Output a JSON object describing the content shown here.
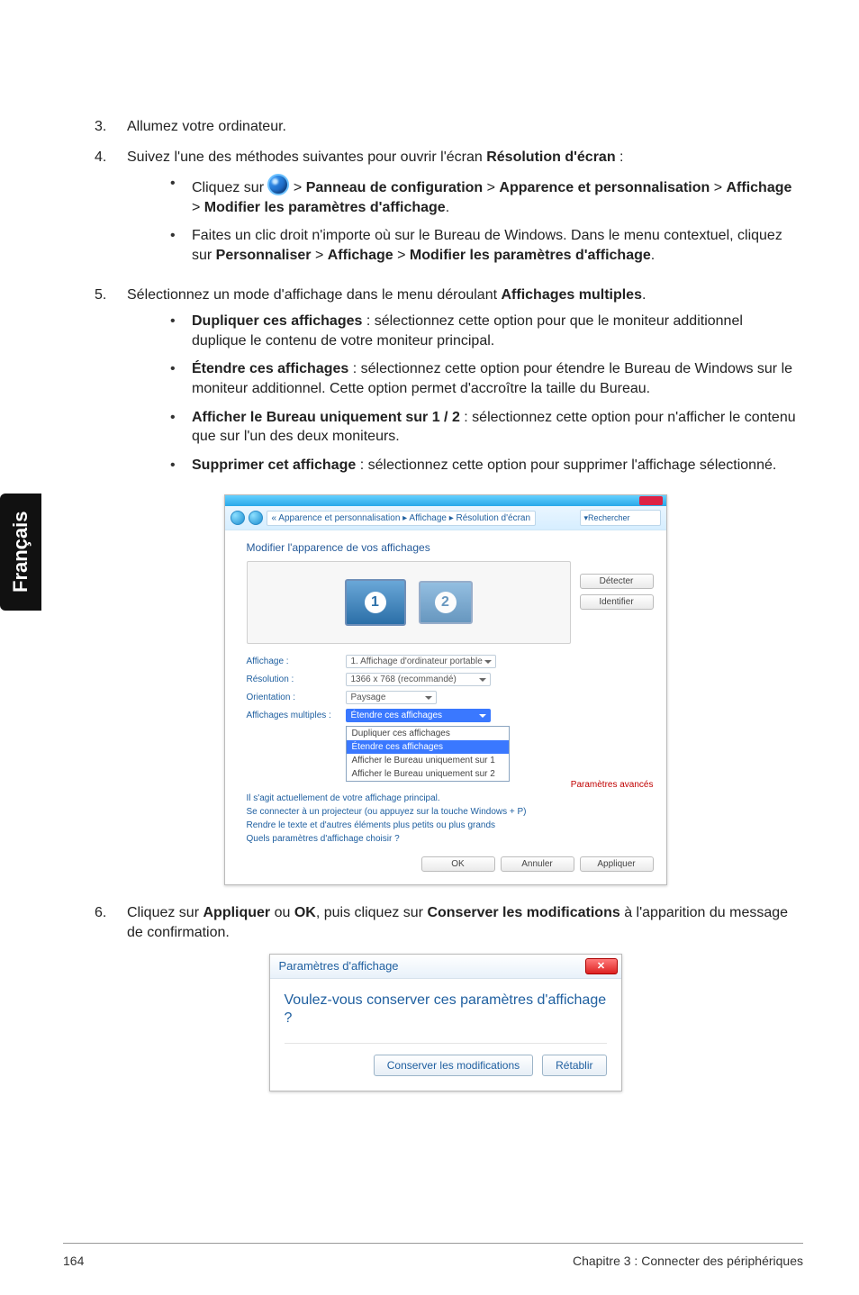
{
  "sidetab": "Français",
  "steps": {
    "s3": {
      "num": "3.",
      "text": "Allumez votre ordinateur."
    },
    "s4": {
      "num": "4.",
      "intro_a": "Suivez l'une des méthodes suivantes pour ouvrir l'écran ",
      "intro_bold": "Résolution d'écran",
      "intro_c": " :",
      "b1a": "Cliquez sur ",
      "b1b": " > ",
      "b1_p1": "Panneau de configuration",
      "b1c": " > ",
      "b1_p2": "Apparence et personnalisation",
      "b1d": " > ",
      "b1_p3": "Affichage",
      "b1e": " > ",
      "b1_p4": "Modifier les paramètres d'affichage",
      "b1f": ".",
      "b2a": "Faites un clic droit n'importe où sur le Bureau de Windows. Dans le menu contextuel, cliquez sur ",
      "b2_p1": "Personnaliser",
      "b2b": " > ",
      "b2_p2": "Affichage",
      "b2c": " > ",
      "b2_p3": "Modifier les paramètres d'affichage",
      "b2d": "."
    },
    "s5": {
      "num": "5.",
      "intro_a": "Sélectionnez un mode d'affichage dans le menu déroulant ",
      "intro_bold": "Affichages multiples",
      "intro_c": ".",
      "b1_t": "Dupliquer ces affichages",
      "b1_r": " : sélectionnez cette option pour que le moniteur additionnel duplique le contenu de votre moniteur principal.",
      "b2_t": "Étendre ces affichages",
      "b2_r": " : sélectionnez cette option pour étendre le Bureau de Windows sur le moniteur additionnel. Cette option permet d'accroître la taille du Bureau.",
      "b3_t": "Afficher le Bureau uniquement sur 1 / 2",
      "b3_r": " : sélectionnez cette option pour n'afficher le contenu que sur l'un des deux moniteurs.",
      "b4_t": "Supprimer cet affichage",
      "b4_r": " : sélectionnez cette option pour supprimer l'affichage sélectionné."
    },
    "s6": {
      "num": "6.",
      "a": "Cliquez sur ",
      "p1": "Appliquer",
      "b": " ou ",
      "p2": "OK",
      "c": ", puis cliquez sur ",
      "p3": "Conserver les modifications",
      "d": " à l'apparition du message de confirmation."
    }
  },
  "win1": {
    "breadcrumb_prefix": "«",
    "bc1": "Apparence et personnalisation",
    "bc2": "Affichage",
    "bc3": "Résolution d'écran",
    "search": "Rechercher",
    "heading": "Modifier l'apparence de vos affichages",
    "mon1": "1",
    "mon2": "2",
    "btn_detect": "Détecter",
    "btn_identify": "Identifier",
    "lab_display": "Affichage :",
    "val_display": "1. Affichage d'ordinateur portable",
    "lab_res": "Résolution :",
    "val_res": "1366 x 768 (recommandé)",
    "lab_orient": "Orientation :",
    "val_orient": "Paysage",
    "lab_multi": "Affichages multiples :",
    "val_multi": "Étendre ces affichages",
    "dd_opt1": "Dupliquer ces affichages",
    "dd_opt2": "Étendre ces affichages",
    "dd_opt3": "Afficher le Bureau uniquement sur 1",
    "dd_opt4": "Afficher le Bureau uniquement sur 2",
    "note1": "Il s'agit actuellement de votre affichage principal.",
    "note2": "Se connecter à un projecteur (ou appuyez sur la touche Windows + P)",
    "note3": "Rendre le texte et d'autres éléments plus petits ou plus grands",
    "note4": "Quels paramètres d'affichage choisir ?",
    "red_note": "Paramètres avancés",
    "btn_ok": "OK",
    "btn_cancel": "Annuler",
    "btn_apply": "Appliquer"
  },
  "win2": {
    "title": "Paramètres d'affichage",
    "close": "✕",
    "question": "Voulez-vous conserver ces paramètres d'affichage ?",
    "btn_keep": "Conserver les modifications",
    "btn_revert": "Rétablir"
  },
  "footer": {
    "page": "164",
    "chapter": "Chapitre 3 : Connecter des périphériques"
  }
}
